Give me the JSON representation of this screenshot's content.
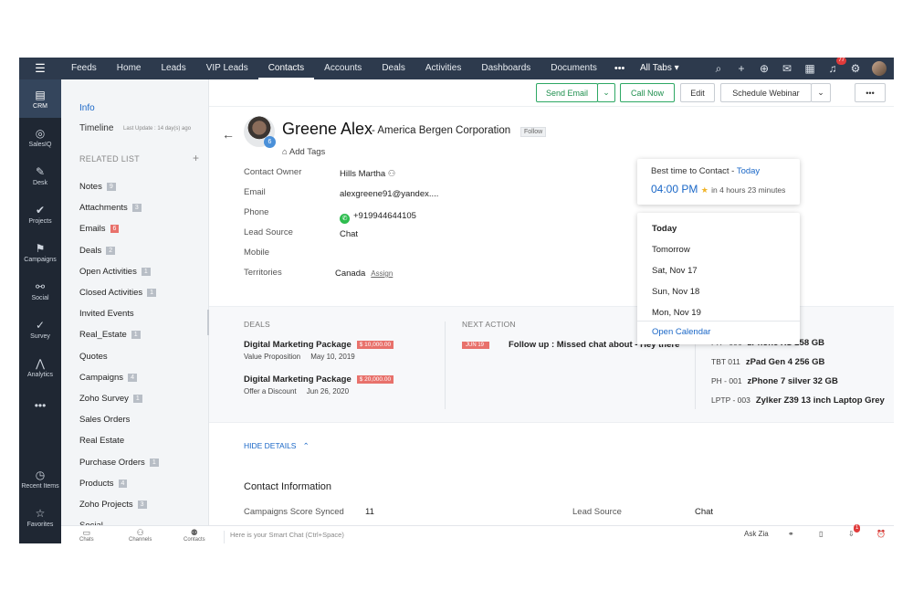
{
  "topnav": {
    "tabs": [
      "Feeds",
      "Home",
      "Leads",
      "VIP Leads",
      "Contacts",
      "Accounts",
      "Deals",
      "Activities",
      "Dashboards",
      "Documents"
    ],
    "more": "•••",
    "all_tabs": "All Tabs ▾",
    "notif_count": "77"
  },
  "rail": {
    "items": [
      "CRM",
      "SalesIQ",
      "Desk",
      "Projects",
      "Campaigns",
      "Social",
      "Survey",
      "Analytics"
    ],
    "more": "•••",
    "recent": "Recent Items",
    "favorites": "Favorites"
  },
  "sidebar": {
    "info": "Info",
    "timeline": "Timeline",
    "last_update": "Last Update : 14 day(s) ago",
    "related_list": "RELATED LIST",
    "items": [
      {
        "label": "Notes",
        "count": "9",
        "red": false
      },
      {
        "label": "Attachments",
        "count": "3",
        "red": false
      },
      {
        "label": "Emails",
        "count": "6",
        "red": true
      },
      {
        "label": "Deals",
        "count": "2",
        "red": false
      },
      {
        "label": "Open Activities",
        "count": "1",
        "red": false
      },
      {
        "label": "Closed Activities",
        "count": "1",
        "red": false
      },
      {
        "label": "Invited Events",
        "count": "",
        "red": false
      },
      {
        "label": "Real_Estate",
        "count": "1",
        "red": false
      },
      {
        "label": "Quotes",
        "count": "",
        "red": false
      },
      {
        "label": "Campaigns",
        "count": "4",
        "red": false
      },
      {
        "label": "Zoho Survey",
        "count": "1",
        "red": false
      },
      {
        "label": "Sales Orders",
        "count": "",
        "red": false
      },
      {
        "label": "Real Estate",
        "count": "",
        "red": false
      },
      {
        "label": "Purchase Orders",
        "count": "1",
        "red": false
      },
      {
        "label": "Products",
        "count": "4",
        "red": false
      },
      {
        "label": "Zoho Projects",
        "count": "3",
        "red": false
      },
      {
        "label": "Social",
        "count": "",
        "red": false
      }
    ]
  },
  "actions": {
    "send_email": "Send Email",
    "call_now": "Call Now",
    "edit": "Edit",
    "schedule": "Schedule Webinar",
    "more": "•••"
  },
  "contact": {
    "name": "Greene Alex",
    "company": "- America Bergen Corporation",
    "follow": "Follow",
    "add_tags": "Add Tags",
    "photo_badge": "6",
    "fields": [
      {
        "label": "Contact Owner",
        "value": "Hills Martha"
      },
      {
        "label": "Email",
        "value": "alexgreene91@yandex...."
      },
      {
        "label": "Phone",
        "value": "+919944644105"
      },
      {
        "label": "Lead Source",
        "value": "Chat"
      },
      {
        "label": "Mobile",
        "value": ""
      },
      {
        "label": "Territories",
        "value": "Canada"
      }
    ],
    "assign": "Assign"
  },
  "summary": {
    "deals_heading": "DEALS",
    "deals": [
      {
        "title": "Digital Marketing Package",
        "amount": "$ 10,000.00",
        "stage": "Value Proposition",
        "date": "May 10, 2019"
      },
      {
        "title": "Digital Marketing Package",
        "amount": "$ 20,000.00",
        "stage": "Offer a Discount",
        "date": "Jun 26, 2020"
      }
    ],
    "next_heading": "NEXT ACTION",
    "next_date": "JUN 19",
    "next_text": "Follow up : Missed chat about - Hey there",
    "products": [
      {
        "code": "PH - 006",
        "name": "zPhone XS 258 GB"
      },
      {
        "code": "TBT 011",
        "name": "zPad Gen 4 256 GB"
      },
      {
        "code": "PH - 001",
        "name": "zPhone 7 silver 32 GB"
      },
      {
        "code": "LPTP - 003",
        "name": "Zylker Z39 13 inch Laptop Grey"
      }
    ]
  },
  "details": {
    "hide": "HIDE DETAILS",
    "section": "Contact Information",
    "rows": [
      {
        "label": "Campaigns Score Synced",
        "value": "11"
      },
      {
        "label": "Lead Source",
        "value": "Chat"
      }
    ]
  },
  "best_time": {
    "title": "Best time to Contact - ",
    "day": "Today",
    "time": "04:00 PM",
    "relative": "in 4 hours 23 minutes"
  },
  "day_menu": {
    "options": [
      "Today",
      "Tomorrow",
      "Sat, Nov 17",
      "Sun, Nov 18",
      "Mon, Nov 19"
    ],
    "open_calendar": "Open Calendar"
  },
  "bottombar": {
    "chats": "Chats",
    "channels": "Channels",
    "contacts": "Contacts",
    "smart_chat": "Here is your Smart Chat (Ctrl+Space)",
    "ask_zia": "Ask Zia",
    "download_count": "1"
  }
}
